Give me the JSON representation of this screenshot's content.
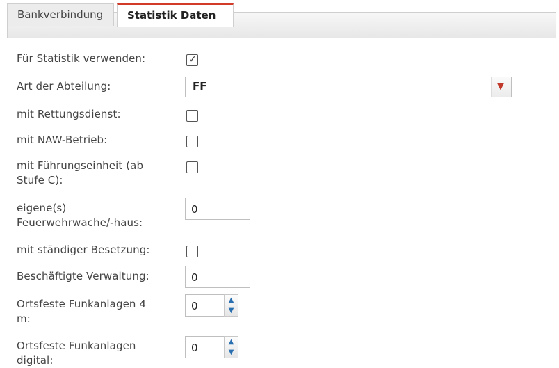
{
  "tabs": [
    {
      "label": "Bankverbindung"
    },
    {
      "label": "Statistik Daten"
    }
  ],
  "fields": {
    "fuer_statistik": {
      "label": "Für Statistik verwenden:",
      "checked": true
    },
    "art_abteilung": {
      "label": "Art der Abteilung:",
      "value": "FF"
    },
    "rettungsdienst": {
      "label": "mit Rettungsdienst:",
      "checked": false
    },
    "naw_betrieb": {
      "label": "mit NAW-Betrieb:",
      "checked": false
    },
    "fuehrungseinheit": {
      "label_line1": "mit Führungseinheit (ab",
      "label_line2": "Stufe C):",
      "checked": false
    },
    "feuerwehrwache": {
      "label_line1": "eigene(s)",
      "label_line2": "Feuerwehrwache/-haus:",
      "value": "0"
    },
    "staendige_besetzung": {
      "label": "mit ständiger Besetzung:",
      "checked": false
    },
    "beschaeftigte_verwaltung": {
      "label": "Beschäftigte Verwaltung:",
      "value": "0"
    },
    "funkanlagen_4m": {
      "label_line1": "Ortsfeste Funkanlagen 4",
      "label_line2": "m:",
      "value": "0"
    },
    "funkanlagen_digital": {
      "label_line1": "Ortsfeste Funkanlagen",
      "label_line2": "digital:",
      "value": "0"
    }
  },
  "icons": {
    "checkmark": "✓",
    "dropdown": "▼",
    "spin_up": "▲",
    "spin_down": "▼"
  },
  "colors": {
    "active_tab_accent": "#d23a2a",
    "dropdown_arrow": "#c0392b",
    "spinner_arrow": "#2a6fb0"
  }
}
